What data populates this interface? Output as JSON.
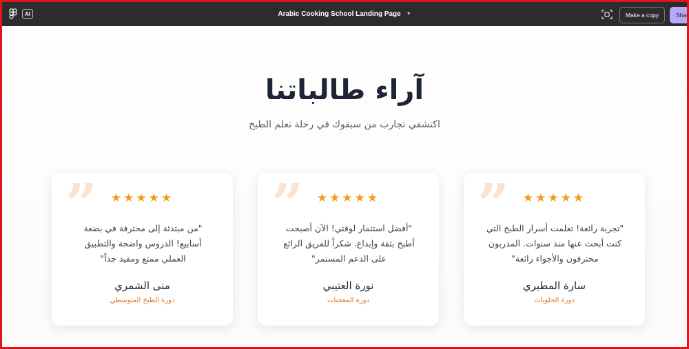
{
  "app": {
    "title": "Arabic Cooking School Landing Page",
    "ai_badge": "AI",
    "make_copy_label": "Make a copy",
    "share_label": "Share"
  },
  "section": {
    "title": "آراء طالباتنا",
    "subtitle": "اكتشفي تجارب من سبقوك في رحلة تعلم الطبخ"
  },
  "testimonials": [
    {
      "quote": "\"من مبتدئة إلى محترفة في بضعة أسابيع! الدروس واضحة والتطبيق العملي ممتع ومفيد جداً\"",
      "name": "منى الشمري",
      "course": "دورة الطبخ المتوسطي",
      "stars": "★★★★★"
    },
    {
      "quote": "\"أفضل استثمار لوقتي! الآن أصبحت أطبخ بثقة وإبداع. شكراً للفريق الرائع على الدعم المستمر\"",
      "name": "نورة العتيبي",
      "course": "دورة المعجنات",
      "stars": "★★★★★"
    },
    {
      "quote": "\"تجربة رائعة! تعلمت أسرار الطبخ التي كنت أبحث عنها منذ سنوات. المدربون محترفون والأجواء رائعة\"",
      "name": "سارة المطيري",
      "course": "دورة الحلويات",
      "stars": "★★★★★"
    }
  ],
  "quote_glyph": "”",
  "colors": {
    "accent": "#e0711f",
    "star": "#f39a1c",
    "topbar": "#2c2c2c",
    "share": "#b6a9f7",
    "frame": "#e0141e"
  }
}
